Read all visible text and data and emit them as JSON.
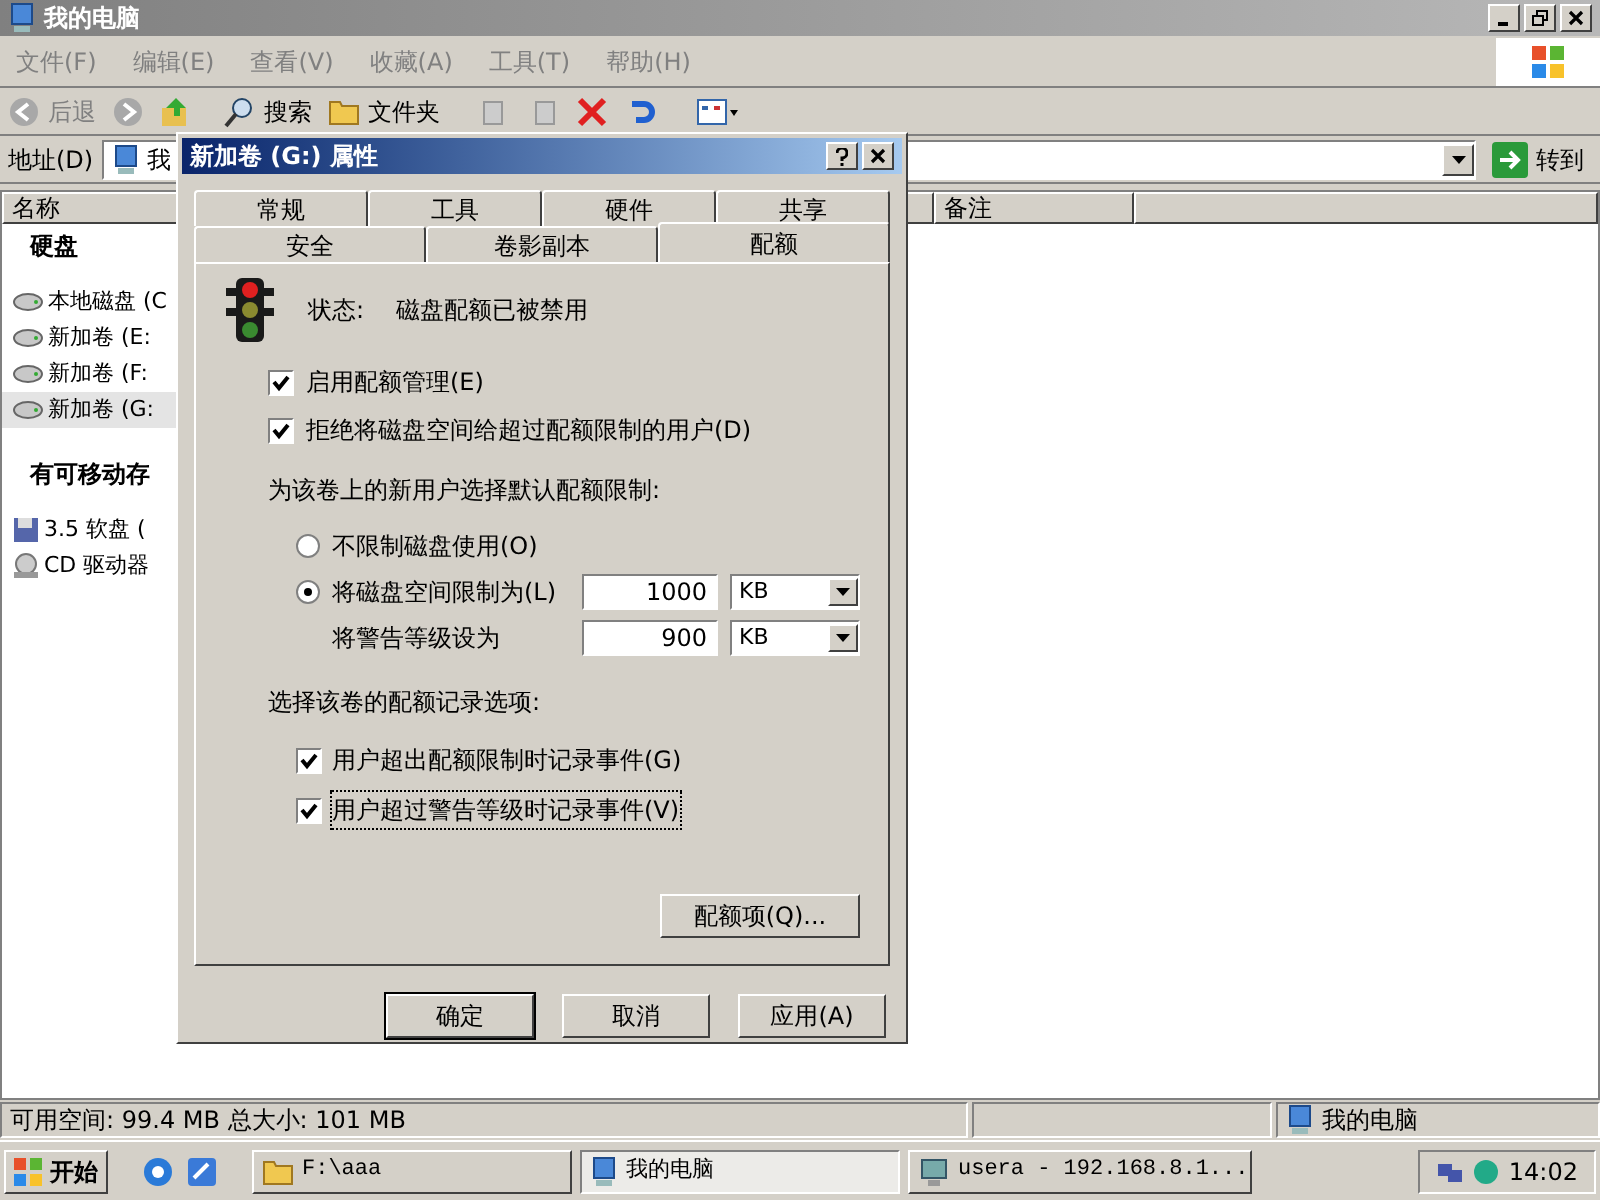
{
  "window": {
    "title": "我的电脑"
  },
  "menu": [
    "文件(F)",
    "编辑(E)",
    "查看(V)",
    "收藏(A)",
    "工具(T)",
    "帮助(H)"
  ],
  "toolbar": {
    "back": "后退",
    "search": "搜索",
    "folders": "文件夹"
  },
  "address": {
    "label": "地址(D)",
    "value": "我",
    "go": "转到"
  },
  "list": {
    "columns": [
      "名称",
      "备注"
    ],
    "groups": [
      {
        "title": "硬盘",
        "items": [
          {
            "name": "本地磁盘 (C",
            "selected": false
          },
          {
            "name": "新加卷 (E:",
            "selected": false
          },
          {
            "name": "新加卷 (F:",
            "selected": false
          },
          {
            "name": "新加卷 (G:",
            "selected": true
          }
        ]
      },
      {
        "title": "有可移动存",
        "items": [
          {
            "name": "3.5 软盘 (",
            "kind": "floppy",
            "selected": false
          },
          {
            "name": "CD 驱动器",
            "kind": "cd",
            "selected": false
          }
        ]
      }
    ]
  },
  "dialog": {
    "title": "新加卷 (G:) 属性",
    "tab_rows": [
      [
        {
          "label": "常规",
          "selected": false
        },
        {
          "label": "工具",
          "selected": false
        },
        {
          "label": "硬件",
          "selected": false
        },
        {
          "label": "共享",
          "selected": false
        }
      ],
      [
        {
          "label": "安全",
          "selected": false
        },
        {
          "label": "卷影副本",
          "selected": false
        },
        {
          "label": "配额",
          "selected": true
        }
      ]
    ],
    "status_label": "状态:",
    "status": "磁盘配额已被禁用",
    "options": [
      {
        "label": "启用配额管理(E)",
        "checked": true
      },
      {
        "label": "拒绝将磁盘空间给超过配额限制的用户(D)",
        "checked": true
      }
    ],
    "default_limit_heading": "为该卷上的新用户选择默认配额限制:",
    "limits": [
      {
        "label": "不限制磁盘使用(O)",
        "selected": false
      },
      {
        "label": "将磁盘空间限制为(L)",
        "selected": true,
        "value": "1000",
        "unit": "KB"
      }
    ],
    "warning": {
      "label": "将警告等级设为",
      "value": "900",
      "unit": "KB"
    },
    "log_heading": "选择该卷的配额记录选项:",
    "log_options": [
      {
        "label": "用户超出配额限制时记录事件(G)",
        "checked": true,
        "focused": false
      },
      {
        "label": "用户超过警告等级时记录事件(V)",
        "checked": true,
        "focused": true
      }
    ],
    "entries_button": "配额项(Q)...",
    "buttons": [
      "确定",
      "取消",
      "应用(A)"
    ]
  },
  "status_bar": {
    "text": "可用空间: 99.4 MB 总大小: 101 MB",
    "location": "我的电脑"
  },
  "taskbar": {
    "start": "开始",
    "tasks": [
      {
        "label": "F:\\aaa",
        "kind": "folder",
        "selected": false
      },
      {
        "label": "我的电脑",
        "kind": "computer",
        "selected": true
      },
      {
        "label": "usera - 192.168.8.1...",
        "kind": "remote",
        "selected": false
      }
    ],
    "clock": "14:02"
  }
}
